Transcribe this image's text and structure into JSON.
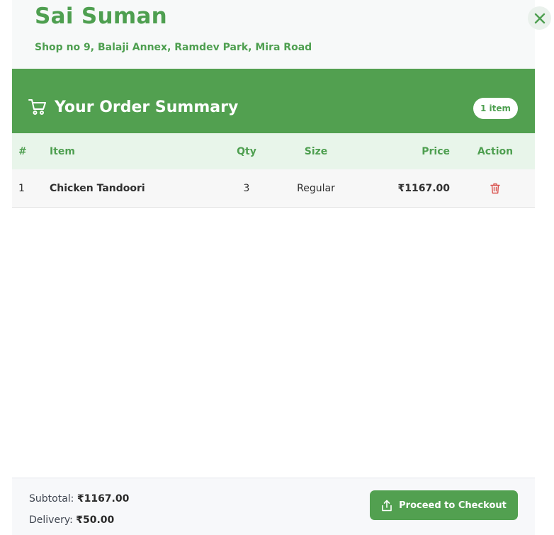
{
  "store": {
    "name": "Sai Suman",
    "address": "Shop no 9, Balaji Annex, Ramdev Park, Mira Road"
  },
  "close_icon": "close-icon",
  "banner": {
    "icon": "cart-icon",
    "title": "Your Order Summary",
    "item_count": "1 item"
  },
  "table": {
    "headers": {
      "num": "#",
      "item": "Item",
      "qty": "Qty",
      "size": "Size",
      "price": "Price",
      "action": "Action"
    },
    "rows": [
      {
        "num": "1",
        "item": "Chicken Tandoori",
        "qty": "3",
        "size": "Regular",
        "price": "₹1167.00",
        "action_icon": "trash-icon"
      }
    ]
  },
  "footer": {
    "subtotal_label": "Subtotal:",
    "subtotal_value": "₹1167.00",
    "delivery_label": "Delivery:",
    "delivery_value": "₹50.00",
    "checkout_icon": "share-upload-icon",
    "checkout_label": "Proceed to Checkout"
  },
  "colors": {
    "brand_green": "#52a050",
    "header_green_text": "#4e9f50",
    "table_head_bg": "#e8f5ea",
    "delete_red": "#d9534f"
  }
}
